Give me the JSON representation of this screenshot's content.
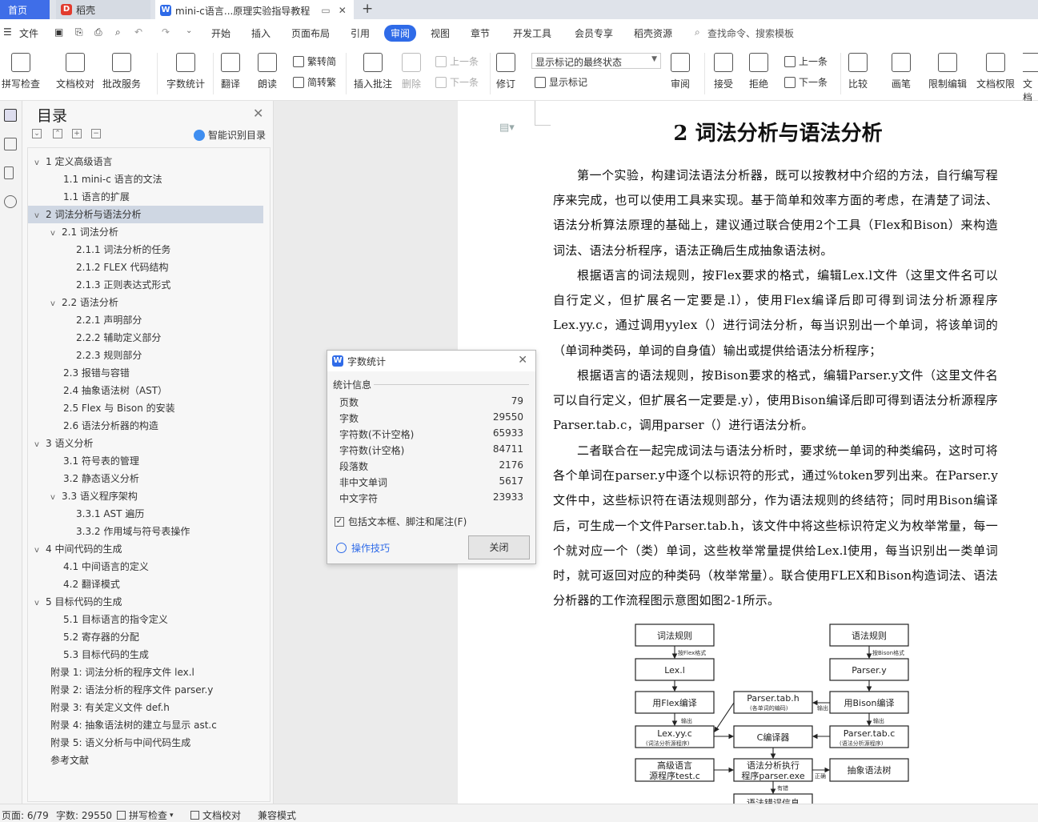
{
  "tabs": {
    "home": "首页",
    "daoke": "稻壳",
    "doc": "mini-c语言...原理实验指导教程",
    "new_tab": "+"
  },
  "menu": {
    "file": "文件",
    "items": [
      "开始",
      "插入",
      "页面布局",
      "引用",
      "审阅",
      "视图",
      "章节",
      "开发工具",
      "会员专享",
      "稻壳资源"
    ],
    "search": "查找命令、搜索模板"
  },
  "ribbon": {
    "spellcheck": "拼写检查",
    "doc_proof": "文档校对",
    "revise_service": "批改服务",
    "word_count": "字数统计",
    "translate": "翻译",
    "read_aloud": "朗读",
    "trad_to_simp": "繁转简",
    "simp_to_trad": "简转繁",
    "insert_comment": "插入批注",
    "delete": "删除",
    "prev_comment": "上一条",
    "next_comment": "下一条",
    "revise": "修订",
    "show_state": "显示标记的最终状态",
    "show_markup": "显示标记",
    "review": "审阅",
    "accept": "接受",
    "reject": "拒绝",
    "prev": "上一条",
    "next": "下一条",
    "compare": "比较",
    "pen": "画笔",
    "restrict_edit": "限制编辑",
    "doc_permission": "文档权限",
    "doc_more": "文档"
  },
  "nav": {
    "title": "目录",
    "smart": "智能识别目录",
    "items": [
      "1 定义高级语言",
      "1.1 mini-c 语言的文法",
      "1.1 语言的扩展",
      "2 词法分析与语法分析",
      "2.1  词法分析",
      "2.1.1  词法分析的任务",
      "2.1.2 FLEX 代码结构",
      "2.1.3  正则表达式形式",
      "2.2  语法分析",
      "2.2.1  声明部分",
      "2.2.2  辅助定义部分",
      "2.2.3  规则部分",
      "2.3  报错与容错",
      "2.4  抽象语法树（AST）",
      "2.5 Flex 与 Bison 的安装",
      "2.6 语法分析器的构造",
      "3 语义分析",
      "3.1  符号表的管理",
      "3.2  静态语义分析",
      "3.3  语义程序架构",
      "3.3.1 AST 遍历",
      "3.3.2  作用域与符号表操作",
      "4 中间代码的生成",
      "4.1  中间语言的定义",
      "4.2  翻译模式",
      "5 目标代码的生成",
      "5.1  目标语言的指令定义",
      "5.2  寄存器的分配",
      "5.3  目标代码的生成",
      "附录 1:    词法分析的程序文件 lex.l",
      "附录 2:    语法分析的程序文件 parser.y",
      "附录 3:    有关定义文件 def.h",
      "附录 4:    抽象语法树的建立与显示 ast.c",
      "附录 5:    语义分析与中间代码生成",
      "参考文献"
    ]
  },
  "document": {
    "title": "2 词法分析与语法分析",
    "paragraphs": [
      "第一个实验，构建词法语法分析器，既可以按教材中介绍的方法，自行编写程序来完成，也可以使用工具来实现。基于简单和效率方面的考虑，在清楚了词法、语法分析算法原理的基础上，建议通过联合使用2个工具（Flex和Bison）来构造词法、语法分析程序，语法正确后生成抽象语法树。",
      "根据语言的词法规则，按Flex要求的格式，编辑Lex.l文件（这里文件名可以自行定义，但扩展名一定要是.l），使用Flex编译后即可得到词法分析源程序Lex.yy.c，通过调用yylex（）进行词法分析，每当识别出一个单词，将该单词的（单词种类码，单词的自身值）输出或提供给语法分析程序；",
      "根据语言的语法规则，按Bison要求的格式，编辑Parser.y文件（这里文件名可以自行定义，但扩展名一定要是.y），使用Bison编译后即可得到语法分析源程序Parser.tab.c，调用parser（）进行语法分析。",
      "二者联合在一起完成词法与语法分析时，要求统一单词的种类编码，这时可将各个单词在parser.y中逐个以标识符的形式，通过%token罗列出来。在Parser.y文件中，这些标识符在语法规则部分，作为语法规则的终结符；同时用Bison编译后，可生成一个文件Parser.tab.h，该文件中将这些标识符定义为枚举常量，每一个就对应一个（类）单词，这些枚举常量提供给Lex.l使用，每当识别出一类单词时，就可返回对应的种类码（枚举常量）。联合使用FLEX和Bison构造词法、语法分析器的工作流程图示意图如图2-1所示。"
    ]
  },
  "flowchart": {
    "lex_rules": "词法规则",
    "syntax_rules": "语法规则",
    "by_flex": "按Flex格式",
    "by_bison": "按Bison格式",
    "lex_l": "Lex.l",
    "parser_y": "Parser.y",
    "flex_compile": "用Flex编译",
    "bison_compile": "用Bison编译",
    "parser_tab_h": "Parser.tab.h",
    "parser_tab_h_sub": "(各单词的编码)",
    "out1": "输出",
    "out2": "输出",
    "out3": "输出",
    "lex_yy_c": "Lex.yy.c",
    "lex_yy_c_sub": "(词法分析源程序)",
    "c_compiler": "C编译器",
    "parser_tab_c": "Parser.tab.c",
    "parser_tab_c_sub": "(语法分析源程序)",
    "hl_src_1": "高级语言",
    "hl_src_2": "源程序test.c",
    "exec_1": "语法分析执行",
    "exec_2": "程序parser.exe",
    "correct": "正确",
    "ast": "抽象语法树",
    "error": "有错",
    "err_info": "语法错误信息"
  },
  "dialog": {
    "title": "字数统计",
    "section": "统计信息",
    "rows": [
      {
        "label": "页数",
        "value": "79"
      },
      {
        "label": "字数",
        "value": "29550"
      },
      {
        "label": "字符数(不计空格)",
        "value": "65933"
      },
      {
        "label": "字符数(计空格)",
        "value": "84711"
      },
      {
        "label": "段落数",
        "value": "2176"
      },
      {
        "label": "非中文单词",
        "value": "5617"
      },
      {
        "label": "中文字符",
        "value": "23933"
      }
    ],
    "include_label": "包括文本框、脚注和尾注(F)",
    "include_checked": true,
    "tips": "操作技巧",
    "close": "关闭"
  },
  "status": {
    "page": "页面: 6/79",
    "words": "字数: 29550",
    "spell": "拼写检查",
    "proof": "文档校对",
    "compat": "兼容模式"
  },
  "colors": {
    "accent": "#2f6be8",
    "home_tab": "#3f6ee8",
    "nav_selected": "#cfd7e3"
  }
}
